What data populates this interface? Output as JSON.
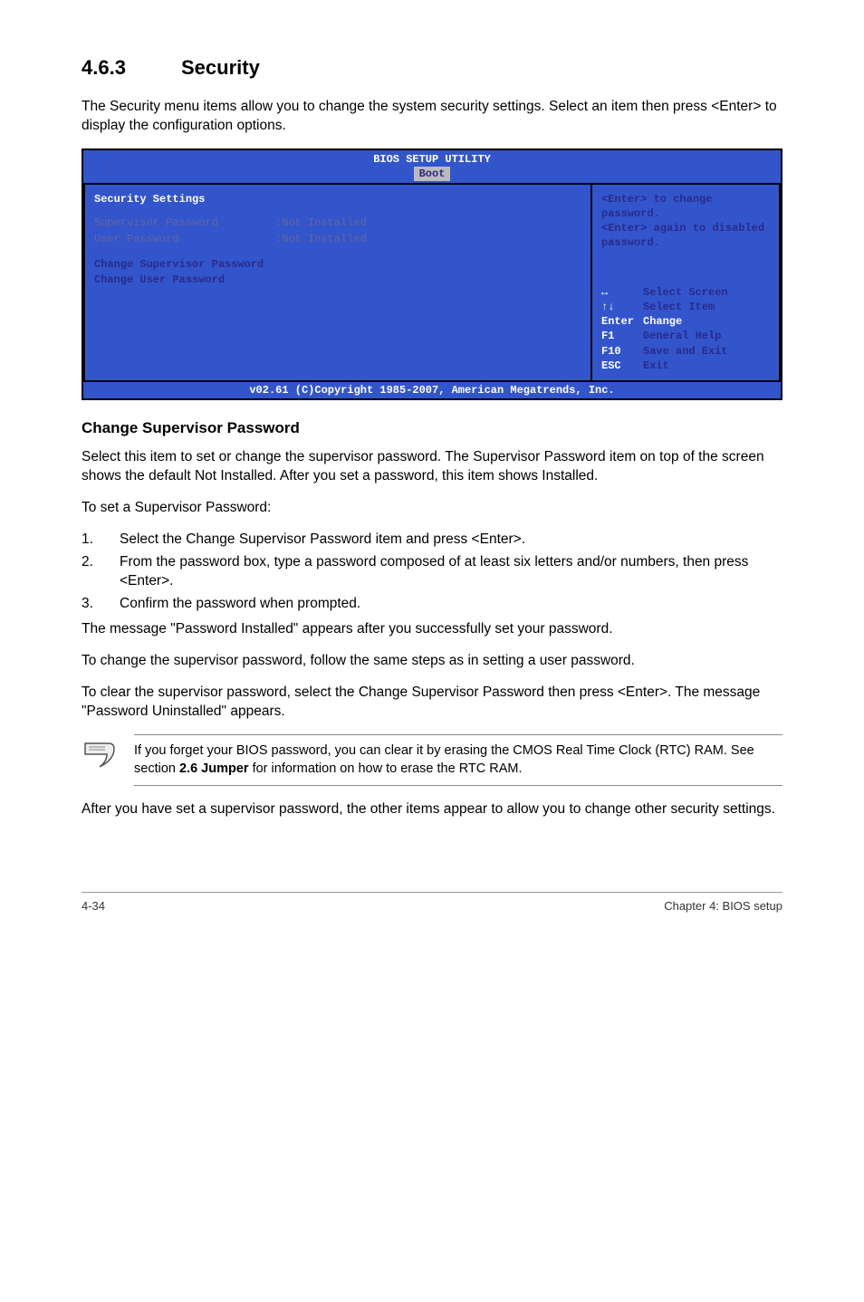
{
  "section": {
    "number": "4.6.3",
    "title": "Security"
  },
  "intro": "The Security menu items allow you to change the system security settings. Select an item then press <Enter> to display the configuration options.",
  "bios": {
    "title": "BIOS SETUP UTILITY",
    "tab": "Boot",
    "left": {
      "heading": "Security Settings",
      "rows": [
        {
          "label": "Supervisor Password",
          "value": ":Not Installed"
        },
        {
          "label": "User Password",
          "value": ":Not Installed"
        }
      ],
      "items": [
        "Change Supervisor Password",
        "Change User Password"
      ]
    },
    "right": {
      "help": [
        "<Enter> to change password.",
        "<Enter> again to disabled password."
      ],
      "nav": [
        {
          "key_glyph": "↔",
          "label": "Select Screen"
        },
        {
          "key_glyph": "↑↓",
          "label": "Select Item"
        },
        {
          "key": "Enter",
          "label": "Change",
          "key_white": true
        },
        {
          "key": "F1",
          "label": "General Help"
        },
        {
          "key": "F10",
          "label": "Save and Exit"
        },
        {
          "key": "ESC",
          "label": "Exit"
        }
      ]
    },
    "footer": "v02.61 (C)Copyright 1985-2007, American Megatrends, Inc."
  },
  "sub1": {
    "heading": "Change Supervisor Password",
    "p1": "Select this item to set or change the supervisor password. The Supervisor Password item on top of the screen shows the default Not Installed. After you set a password, this item shows Installed.",
    "p2": "To set a Supervisor Password:",
    "steps": [
      "Select the Change Supervisor Password item and press <Enter>.",
      "From the password box, type a password composed of at least six letters and/or numbers, then press <Enter>.",
      "Confirm the password when prompted."
    ],
    "p3": "The message \"Password Installed\" appears after you successfully set your password.",
    "p4": "To change the supervisor password, follow the same steps as in setting a user password.",
    "p5": "To clear the supervisor password, select the Change Supervisor Password then press <Enter>. The message \"Password Uninstalled\" appears."
  },
  "note": {
    "text_before": "If you forget your BIOS password, you can clear it by erasing the CMOS Real Time Clock (RTC) RAM. See section ",
    "bold": "2.6 Jumper",
    "text_after": " for information on how to erase the RTC RAM."
  },
  "after_note": "After you have set a supervisor password, the other items appear to allow you to change other security settings.",
  "footer": {
    "left": "4-34",
    "right": "Chapter 4: BIOS setup"
  }
}
